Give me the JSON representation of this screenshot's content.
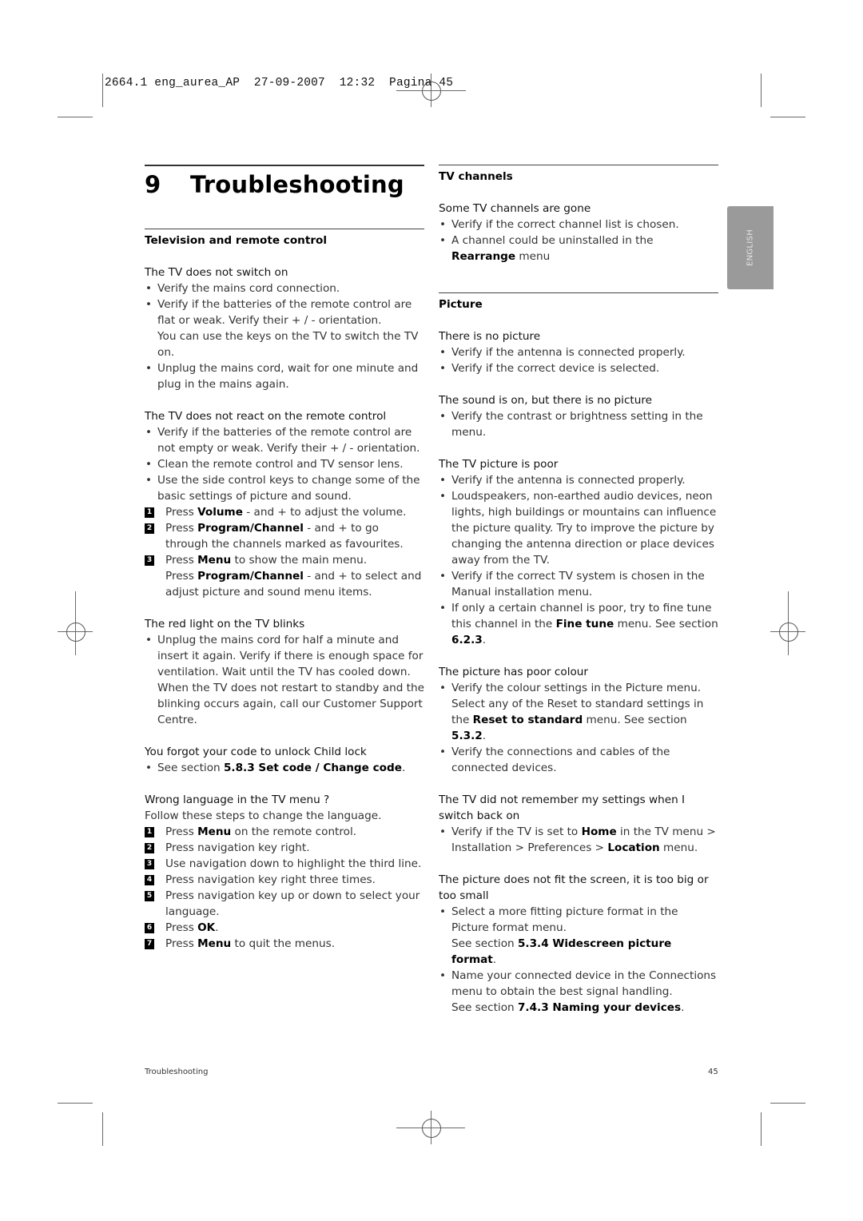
{
  "slug_line": "2664.1 eng_aurea_AP  27-09-2007  12:32  Pagina 45",
  "chapter": {
    "number": "9",
    "title": "Troubleshooting"
  },
  "language_tab": "ENGLISH",
  "left_column": {
    "section_title": "Television and remote control",
    "problems": [
      {
        "question": "The TV does not switch on",
        "bullets": [
          "Verify the mains cord connection.",
          "Verify if the batteries of the remote control are flat or weak. Verify their + / - orientation.",
          "Unplug the mains cord, wait for one minute and plug in the mains again."
        ],
        "bullet2_note": "You can use the keys on the TV to switch the TV on."
      },
      {
        "question": "The TV does not react on the remote control",
        "bullets": [
          "Verify if the batteries of the remote control are not empty or weak. Verify their + / - orientation.",
          "Clean the remote control and TV sensor lens.",
          "Use the side control keys to change some of the basic settings of picture and sound."
        ],
        "steps": [
          {
            "n": "1",
            "pre": "Press ",
            "bold": "Volume",
            "post": " - and + to adjust the volume."
          },
          {
            "n": "2",
            "pre": "Press ",
            "bold": "Program/Channel",
            "post": " - and + to go through the channels marked as favourites."
          },
          {
            "n": "3",
            "pre": "Press ",
            "bold": "Menu",
            "post": " to show the main menu."
          }
        ],
        "step3_extra": {
          "pre": "Press ",
          "bold": "Program/Channel",
          "post": " - and + to select and adjust picture and sound menu items."
        }
      },
      {
        "question": "The red light on the TV blinks",
        "bullets": [
          "Unplug the mains cord for half a minute and insert it again. Verify if there is enough space for ventilation. Wait until the TV has cooled down. When the TV does not restart to standby and the blinking occurs again, call our Customer Support Centre."
        ]
      },
      {
        "question": "You forgot your code to unlock Child lock",
        "bullet": {
          "pre": "See section ",
          "bold": "5.8.3 Set code / Change code",
          "post": "."
        }
      },
      {
        "question": "Wrong language in the TV menu ?",
        "intro": "Follow these steps to change the language.",
        "steps": [
          {
            "n": "1",
            "pre": "Press ",
            "bold": "Menu",
            "post": " on the remote control."
          },
          {
            "n": "2",
            "pre": "Press navigation key right.",
            "bold": "",
            "post": ""
          },
          {
            "n": "3",
            "pre": "Use navigation down to highlight the third line.",
            "bold": "",
            "post": ""
          },
          {
            "n": "4",
            "pre": "Press navigation key right three times.",
            "bold": "",
            "post": ""
          },
          {
            "n": "5",
            "pre": "Press navigation key up or down to select your language.",
            "bold": "",
            "post": ""
          },
          {
            "n": "6",
            "pre": "Press ",
            "bold": "OK",
            "post": "."
          },
          {
            "n": "7",
            "pre": "Press ",
            "bold": "Menu",
            "post": " to quit the menus."
          }
        ]
      }
    ]
  },
  "right_column": {
    "tv_channels": {
      "section_title": "TV channels",
      "question": "Some TV channels are gone",
      "bullet1": "Verify if the correct channel list is chosen.",
      "bullet2": {
        "pre": "A channel could be uninstalled in the ",
        "bold": "Rearrange",
        "post": " menu"
      }
    },
    "picture": {
      "section_title": "Picture",
      "p1": {
        "question": "There is no picture",
        "bullets": [
          "Verify if the antenna is connected properly.",
          "Verify if the correct device is selected."
        ]
      },
      "p2": {
        "question": "The sound is on, but there is no picture",
        "bullets": [
          "Verify the contrast or brightness setting in the menu."
        ]
      },
      "p3": {
        "question": "The TV picture is poor",
        "bullets": [
          "Verify if the antenna is connected properly.",
          "Loudspeakers, non-earthed audio devices, neon lights, high buildings or mountains can influence the picture quality. Try to improve the picture by changing the antenna direction or place devices away from the TV.",
          "Verify if the correct TV system is chosen in the Manual installation menu."
        ],
        "bullet4": {
          "pre": "If only a certain channel is poor, try to fine tune this channel in the ",
          "bold": "Fine tune",
          "mid": " menu. See section ",
          "bold2": "6.2.3",
          "post": "."
        }
      },
      "p4": {
        "question": "The picture has poor colour",
        "bullet1": {
          "pre": "Verify the colour settings in the Picture menu. Select any of the Reset to standard settings in the ",
          "bold": "Reset to standard",
          "mid": " menu. See section ",
          "bold2": "5.3.2",
          "post": "."
        },
        "bullet2": "Verify the connections and cables of the connected devices."
      },
      "p5": {
        "question": "The TV did not remember my settings when I switch back on",
        "bullet1": {
          "pre": "Verify if the TV is set to ",
          "bold": "Home",
          "mid": " in the TV menu > Installation > Preferences > ",
          "bold2": "Location",
          "post": " menu."
        }
      },
      "p6": {
        "question": "The picture does not fit the screen, it is too big or too small",
        "bullet1": "Select a more fitting picture format in the Picture format menu.",
        "bullet1_see": {
          "pre": "See section ",
          "bold": "5.3.4 Widescreen picture format",
          "post": "."
        },
        "bullet2": "Name your connected device in the Connections menu to obtain the best signal handling.",
        "bullet2_see": {
          "pre": "See section ",
          "bold": "7.4.3 Naming your devices",
          "post": "."
        }
      }
    }
  },
  "footer": {
    "section": "Troubleshooting",
    "page": "45"
  }
}
